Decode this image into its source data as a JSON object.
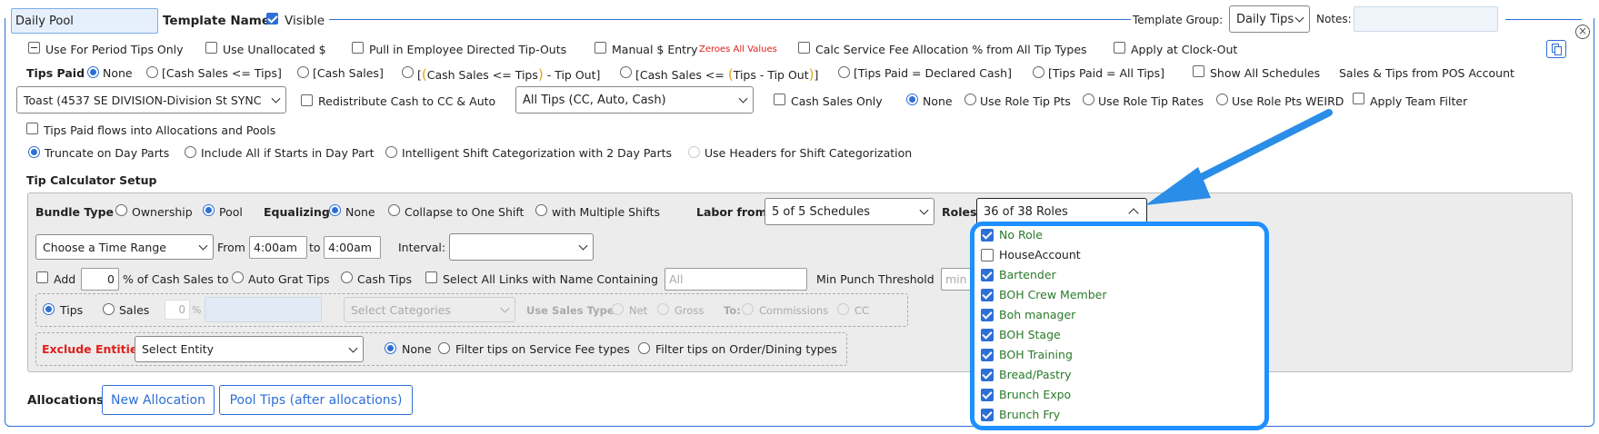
{
  "header": {
    "name_value": "Daily Pool",
    "template_name_label": "Template Name",
    "visible_label": "Visible",
    "template_group_label": "Template Group:",
    "template_group_value": "Daily Tips",
    "notes_label": "Notes:"
  },
  "row1": {
    "period_only": "Use For Period Tips Only",
    "unallocated": "Use Unallocated $",
    "pull_in": "Pull in Employee Directed Tip-Outs",
    "manual_entry": "Manual $ Entry",
    "zeroes": "Zeroes All Values",
    "calc_fee": "Calc Service Fee Allocation % from All Tip Types",
    "clock_out": "Apply at Clock-Out"
  },
  "row2": {
    "tips_paid_label": "Tips Paid",
    "none": "None",
    "opt1": "[Cash Sales <= Tips]",
    "opt2": "[Cash Sales]",
    "opt3_a": "[",
    "opt3_b": "(",
    "opt3_c": "Cash Sales <= Tips",
    "opt3_d": ")",
    "opt3_e": " - Tip Out]",
    "opt4_a": "[Cash Sales <= ",
    "opt4_b": "(",
    "opt4_c": "Tips - Tip Out",
    "opt4_d": ")",
    "opt4_e": "]",
    "opt5": "[Tips Paid = Declared Cash]",
    "opt6": "[Tips Paid = All Tips]",
    "show_schedules": "Show All Schedules",
    "sales_tips_pos": "Sales & Tips from POS Account"
  },
  "row3": {
    "pos_account": "Toast (4537 SE DIVISION-Division St SYNC",
    "redistribute": "Redistribute Cash to CC & Auto",
    "tip_types": "All Tips (CC, Auto, Cash)",
    "cash_only": "Cash Sales Only",
    "none": "None",
    "role_tip_pts": "Use Role Tip Pts",
    "role_tip_rates": "Use Role Tip Rates",
    "role_pts_weird": "Use Role Pts WEIRD",
    "team_filter": "Apply Team Filter"
  },
  "row4": {
    "flows": "Tips Paid flows into Allocations and Pools"
  },
  "row5": {
    "truncate": "Truncate on Day Parts",
    "include_all": "Include All if Starts in Day Part",
    "intelligent": "Intelligent Shift Categorization with 2 Day Parts",
    "headers": "Use Headers for Shift Categorization"
  },
  "setup": {
    "title": "Tip Calculator Setup",
    "bundle_type": "Bundle Type",
    "ownership": "Ownership",
    "pool": "Pool",
    "equalizing": "Equalizing",
    "none": "None",
    "collapse": "Collapse to One Shift",
    "multiple": "with Multiple Shifts",
    "labor_from": "Labor from",
    "labor_value": "5 of 5 Schedules",
    "roles": "Roles",
    "roles_value": "36 of 38 Roles",
    "time_range": "Choose a Time Range",
    "from": "From",
    "from_value": "4:00am",
    "to": "to",
    "to_value": "4:00am",
    "interval": "Interval:",
    "add": "Add",
    "add_value": "0",
    "pct_cash": "% of Cash Sales to",
    "auto_grat": "Auto Grat Tips",
    "cash_tips": "Cash Tips",
    "select_links": "Select All Links with Name Containing",
    "links_placeholder": "All",
    "min_punch": "Min Punch Threshold",
    "min_placeholder": "min",
    "tips": "Tips",
    "sales": "Sales",
    "sales_value": "0",
    "pct": "%",
    "select_categories": "Select Categories",
    "use_sales_type": "Use Sales Type:",
    "net": "Net",
    "gross": "Gross",
    "to_label": "To:",
    "commissions": "Commissions",
    "cc": "CC",
    "exclude": "Exclude Entities",
    "select_entity": "Select Entity",
    "none2": "None",
    "filter_fee": "Filter tips on Service Fee types",
    "filter_order": "Filter tips on Order/Dining types"
  },
  "footer": {
    "allocations": "Allocations",
    "new_allocation": "New Allocation",
    "pool_tips": "Pool Tips (after allocations)"
  },
  "roles_dropdown": [
    {
      "label": "No Role",
      "checked": true
    },
    {
      "label": "HouseAccount",
      "checked": false
    },
    {
      "label": "Bartender",
      "checked": true
    },
    {
      "label": "BOH Crew Member",
      "checked": true
    },
    {
      "label": "Boh manager",
      "checked": true
    },
    {
      "label": "BOH Stage",
      "checked": true
    },
    {
      "label": "BOH Training",
      "checked": true
    },
    {
      "label": "Bread/Pastry",
      "checked": true
    },
    {
      "label": "Brunch Expo",
      "checked": true
    },
    {
      "label": "Brunch Fry",
      "checked": true
    }
  ],
  "colors": {
    "accent": "#2e6fd6",
    "highlight": "#1e90ff",
    "checked_text": "#2a7a2a",
    "warning": "#e0201c"
  },
  "icons": {
    "close": "close-circle-icon",
    "copy": "copy-icon",
    "arrow": "pointer-arrow-icon"
  }
}
